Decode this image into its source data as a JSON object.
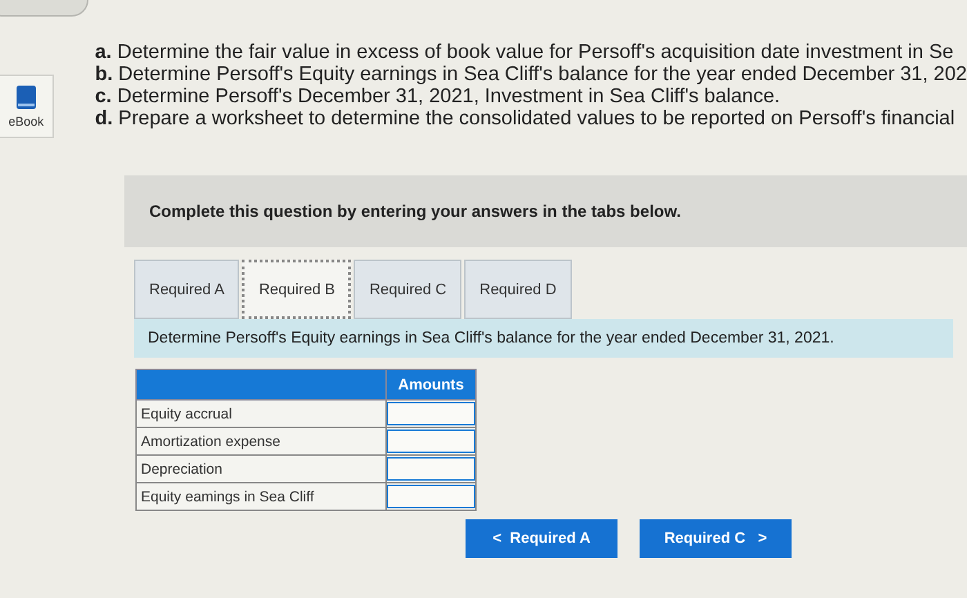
{
  "ebook": {
    "label": "eBook"
  },
  "questions": [
    "**a.** Determine the fair value in excess of book value for Persoff's acquisition date investment in Se",
    "**b.** Determine Persoff's Equity earnings in Sea Cliff's balance for the year ended December 31, 202",
    "**c.** Determine Persoff's December 31, 2021, Investment in Sea Cliff's balance.",
    "**d.** Prepare a worksheet to determine the consolidated values to be reported on Persoff's financial"
  ],
  "prompt": "Complete this question by entering your answers in the tabs below.",
  "tabs": [
    {
      "label": "Required A",
      "selected": false
    },
    {
      "label": "Required B",
      "selected": true
    },
    {
      "label": "Required C",
      "selected": false
    },
    {
      "label": "Required D",
      "selected": false
    }
  ],
  "instruction": "Determine Persoff's Equity earnings in Sea Cliff's balance for the year ended December 31, 2021.",
  "table": {
    "columns": [
      "Amounts"
    ],
    "rows": [
      {
        "label": "Equity accrual"
      },
      {
        "label": "Amortization expense"
      },
      {
        "label": "Depreciation"
      },
      {
        "label": "Equity eamings in Sea Cliff"
      }
    ]
  },
  "nav": {
    "prev": {
      "arrow": "<",
      "label": "Required A"
    },
    "next": {
      "label": "Required C",
      "arrow": ">"
    }
  }
}
